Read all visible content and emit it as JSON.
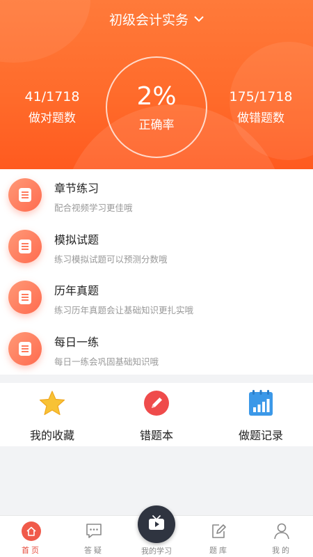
{
  "header": {
    "subject": "初级会计实务",
    "correct_count": "41/1718",
    "correct_label": "做对题数",
    "rate": "2%",
    "rate_label": "正确率",
    "wrong_count": "175/1718",
    "wrong_label": "做错题数"
  },
  "list": [
    {
      "title": "章节练习",
      "subtitle": "配合视频学习更佳哦",
      "icon": "document-icon"
    },
    {
      "title": "模拟试题",
      "subtitle": "练习模拟试题可以预测分数哦",
      "icon": "document-icon"
    },
    {
      "title": "历年真题",
      "subtitle": "练习历年真题会让基础知识更扎实哦",
      "icon": "document-icon"
    },
    {
      "title": "每日一练",
      "subtitle": "每日一练会巩固基础知识哦",
      "icon": "document-icon"
    }
  ],
  "tools": [
    {
      "label": "我的收藏",
      "icon": "star-icon"
    },
    {
      "label": "错题本",
      "icon": "pencil-icon"
    },
    {
      "label": "做题记录",
      "icon": "bar-chart-icon"
    }
  ],
  "nav": {
    "home": "首页",
    "qa": "答疑",
    "study": "我的学习",
    "bank": "题库",
    "me": "我的"
  },
  "colors": {
    "primary": "#ff6a2a",
    "active": "#e64a3b",
    "center_button": "#2f3440"
  }
}
